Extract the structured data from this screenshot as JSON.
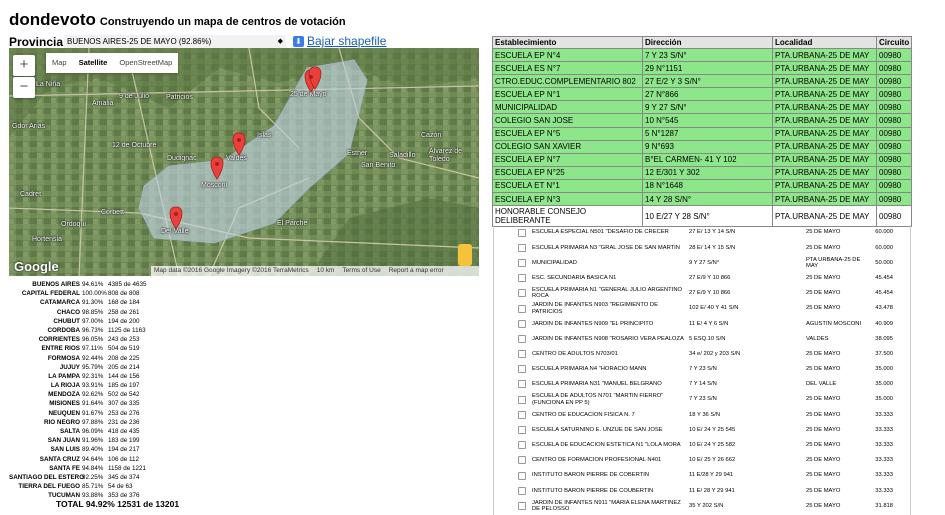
{
  "app": {
    "title": "dondevoto",
    "subtitle": "Construyendo un mapa de centros de votación"
  },
  "province": {
    "label": "Provincia:",
    "selected": "BUENOS AIRES-25 DE MAYO (92.86%)"
  },
  "download": {
    "label": "Bajar shapefile",
    "icon": "download-icon"
  },
  "map": {
    "zoom_in": "+",
    "zoom_out": "−",
    "types": [
      "Map",
      "Satellite",
      "OpenStreetMap"
    ],
    "active_type": "Satellite",
    "place_labels": [
      "La Niña",
      "9 de Julio",
      "Patricios",
      "Amalia",
      "25 de Mayo",
      "Gdor Arias",
      "12 de Octubre",
      "Islas",
      "Cazón",
      "Saladillo",
      "Dudignac",
      "Valdés",
      "Esther",
      "San Benito",
      "Alvarez de Toledo",
      "Cadret",
      "Mosconi",
      "Corbett",
      "Ordoqui",
      "El Parche",
      "Del Valle",
      "Hortensia"
    ],
    "route_labels": [
      "65",
      "205",
      "51",
      "61",
      "46",
      "5",
      "51",
      "65",
      "51",
      "205",
      "205"
    ],
    "logo": "Google",
    "footer": [
      "Map data ©2016 Google Imagery ©2016 TerraMetrics",
      "10 km",
      "Terms of Use",
      "Report a map error"
    ]
  },
  "stats": {
    "rows": [
      {
        "name": "BUENOS AIRES",
        "pct": "94.61%",
        "count": "4385 de 4635"
      },
      {
        "name": "CAPITAL FEDERAL",
        "pct": "100.00%",
        "count": "808 de 808"
      },
      {
        "name": "CATAMARCA",
        "pct": "91.30%",
        "count": "168 de 184"
      },
      {
        "name": "CHACO",
        "pct": "98.85%",
        "count": "258 de 261"
      },
      {
        "name": "CHUBUT",
        "pct": "97.00%",
        "count": "194 de 200"
      },
      {
        "name": "CORDOBA",
        "pct": "96.73%",
        "count": "1125 de 1163"
      },
      {
        "name": "CORRIENTES",
        "pct": "96.05%",
        "count": "243 de 253"
      },
      {
        "name": "ENTRE RIOS",
        "pct": "97.11%",
        "count": "504 de 519"
      },
      {
        "name": "FORMOSA",
        "pct": "92.44%",
        "count": "208 de 225"
      },
      {
        "name": "JUJUY",
        "pct": "95.79%",
        "count": "205 de 214"
      },
      {
        "name": "LA PAMPA",
        "pct": "92.31%",
        "count": "144 de 156"
      },
      {
        "name": "LA RIOJA",
        "pct": "93.91%",
        "count": "185 de 197"
      },
      {
        "name": "MENDOZA",
        "pct": "92.62%",
        "count": "502 de 542"
      },
      {
        "name": "MISIONES",
        "pct": "91.64%",
        "count": "307 de 335"
      },
      {
        "name": "NEUQUEN",
        "pct": "91.67%",
        "count": "253 de 276"
      },
      {
        "name": "RIO NEGRO",
        "pct": "97.88%",
        "count": "231 de 236"
      },
      {
        "name": "SALTA",
        "pct": "96.09%",
        "count": "418 de 435"
      },
      {
        "name": "SAN JUAN",
        "pct": "91.96%",
        "count": "183 de 199"
      },
      {
        "name": "SAN LUIS",
        "pct": "89.40%",
        "count": "194 de 217"
      },
      {
        "name": "SANTA CRUZ",
        "pct": "94.64%",
        "count": "106 de 112"
      },
      {
        "name": "SANTA FE",
        "pct": "94.84%",
        "count": "1158 de 1221"
      },
      {
        "name": "SANTIAGO DEL ESTERO",
        "pct": "92.25%",
        "count": "345 de 374"
      },
      {
        "name": "TIERRA DEL FUEGO",
        "pct": "85.71%",
        "count": "54 de 63"
      },
      {
        "name": "TUCUMAN",
        "pct": "93.88%",
        "count": "353 de 376"
      }
    ],
    "total": {
      "label": "TOTAL",
      "pct": "94.92%",
      "count": "12531 de 13201"
    }
  },
  "table": {
    "headers": [
      "Establecimiento",
      "Dirección",
      "Localidad",
      "Circuito"
    ],
    "rows": [
      [
        "ESCUELA EP N°4",
        "7 Y 23 S/N°",
        "PTA.URBANA-25 DE MAY",
        "00980"
      ],
      [
        "ESCUELA ES N°7",
        "29 N°1151",
        "PTA.URBANA-25 DE MAY",
        "00980"
      ],
      [
        "CTRO.EDUC.COMPLEMENTARIO 802",
        "27 E/2 Y 3 S/N°",
        "PTA.URBANA-25 DE MAY",
        "00980"
      ],
      [
        "ESCUELA EP N°1",
        "27 N°866",
        "PTA.URBANA-25 DE MAY",
        "00980"
      ],
      [
        "MUNICIPALIDAD",
        "9 Y 27 S/N°",
        "PTA.URBANA-25 DE MAY",
        "00980"
      ],
      [
        "COLEGIO SAN JOSE",
        "10 N°545",
        "PTA.URBANA-25 DE MAY",
        "00980"
      ],
      [
        "ESCUELA EP N°5",
        "5 N°1287",
        "PTA.URBANA-25 DE MAY",
        "00980"
      ],
      [
        "COLEGIO SAN XAVIER",
        "9 N°693",
        "PTA.URBANA-25 DE MAY",
        "00980"
      ],
      [
        "ESCUELA EP N°7",
        "B°EL CARMEN- 41 Y 102",
        "PTA.URBANA-25 DE MAY",
        "00980"
      ],
      [
        "ESCUELA EP N°25",
        "12 E/301 Y 302",
        "PTA.URBANA-25 DE MAY",
        "00980"
      ],
      [
        "ESCUELA ET N°1",
        "18 N°1648",
        "PTA.URBANA-25 DE MAY",
        "00980"
      ],
      [
        "ESCUELA EP N°3",
        "14 Y 28 S/N°",
        "PTA.URBANA-25 DE MAY",
        "00980"
      ]
    ],
    "last_row": [
      "HONORABLE CONSEJO DELIBERANTE",
      "10 E/27 Y 28 S/N°",
      "PTA.URBANA-25 DE MAY",
      "00980"
    ]
  },
  "list": {
    "rows": [
      [
        "ESCUELA ESPECIAL N501 \"DESAFIO DE CRECER",
        "27 E/ 13 Y 14 S/N",
        "25 DE MAYO",
        "60.000"
      ],
      [
        "ESCUELA PRIMARIA N3 \"GRAL JOSE DE SAN MARTIN",
        "28 E/ 14 Y 15 S/N",
        "25 DE MAYO",
        "60.000"
      ],
      [
        "MUNICIPALIDAD",
        "9 Y 27 S/N°",
        "PTA URBANA-25 DE MAY",
        "50.000"
      ],
      [
        "ESC. SECUNDARIA BASICA N1",
        "27 E/9 Y 10 866",
        "25 DE MAYO",
        "45.454"
      ],
      [
        "ESCUELA PRIMARIA N1 \"GENERAL JULIO ARGENTINO ROCA",
        "27 E/9 Y 10 866",
        "25 DE MAYO",
        "45.454"
      ],
      [
        "JARDIN DE INFANTES N903 \"REGIMIENTO DE PATRICIOS",
        "102 E/ 40 Y 41 S/N",
        "25 DE MAYO",
        "43.478"
      ],
      [
        "JARDIN DE INFANTES N909 \"EL PRINCIPITO",
        "11 E/ 4 Y 6 S/N",
        "AGUSTIN MOSCONI",
        "40.909"
      ],
      [
        "JARDIN DE INFANTES N908 \"ROSARIO VERA PEALOZA",
        "5 ESQ.10 S/N",
        "VALDES",
        "38.095"
      ],
      [
        "CENTRO DE ADULTOS N703/01",
        "34 e/ 202 y 203 S/N",
        "25 DE MAYO",
        "37.500"
      ],
      [
        "ESCUELA PRIMARIA N4 \"HORACIO MANN",
        "7 Y 23 S/N",
        "25 DE MAYO",
        "35.000"
      ],
      [
        "ESCUELA PRIMARIA N31 \"MANUEL BELGRANO",
        "7 Y 14 S/N",
        "DEL VALLE",
        "35.000"
      ],
      [
        "ESCUELA DE ADULTOS N701 \"MARTIN FIERRO\" (FUNCIONA EN PP 5)",
        "7 Y 23 S/N",
        "25 DE MAYO",
        "35.000"
      ],
      [
        "CENTRO DE EDUCACION FISICA N. 7",
        "18 Y 36 S/N",
        "25 DE MAYO",
        "33.333"
      ],
      [
        "ESCUELA SATURNINO E. UNZUE DE SAN JOSE",
        "10 E/ 24 Y 25 545",
        "25 DE MAYO",
        "33.333"
      ],
      [
        "ESCUELA DE EDUCACION ESTETICA N1 \"LOLA MORA",
        "10 E/ 24 Y 25 582",
        "25 DE MAYO",
        "33.333"
      ],
      [
        "CENTRO DE FORMACION PROFESIONAL N401",
        "10 E/ 25 Y 26 662",
        "25 DE MAYO",
        "33.333"
      ],
      [
        "INSTITUTO BARON PIERRE DE COBERTIN",
        "11 E/28 Y 29 941",
        "25 DE MAYO",
        "33.333"
      ],
      [
        "INSTITUTO BARON PIERRE DE COUBERTIN",
        "11 E/ 28 Y 29 941",
        "25 DE MAYO",
        "33.333"
      ],
      [
        "JARDIN DE INFANTES N911 \"MARIA ELENA MARTINEZ DE PELOSSO",
        "35 Y 202 S/N",
        "25 DE MAYO",
        "31.818"
      ]
    ]
  },
  "colors": {
    "highlight": "#8ee68a",
    "link": "#1a5fb4",
    "marker": "#e8413c"
  }
}
